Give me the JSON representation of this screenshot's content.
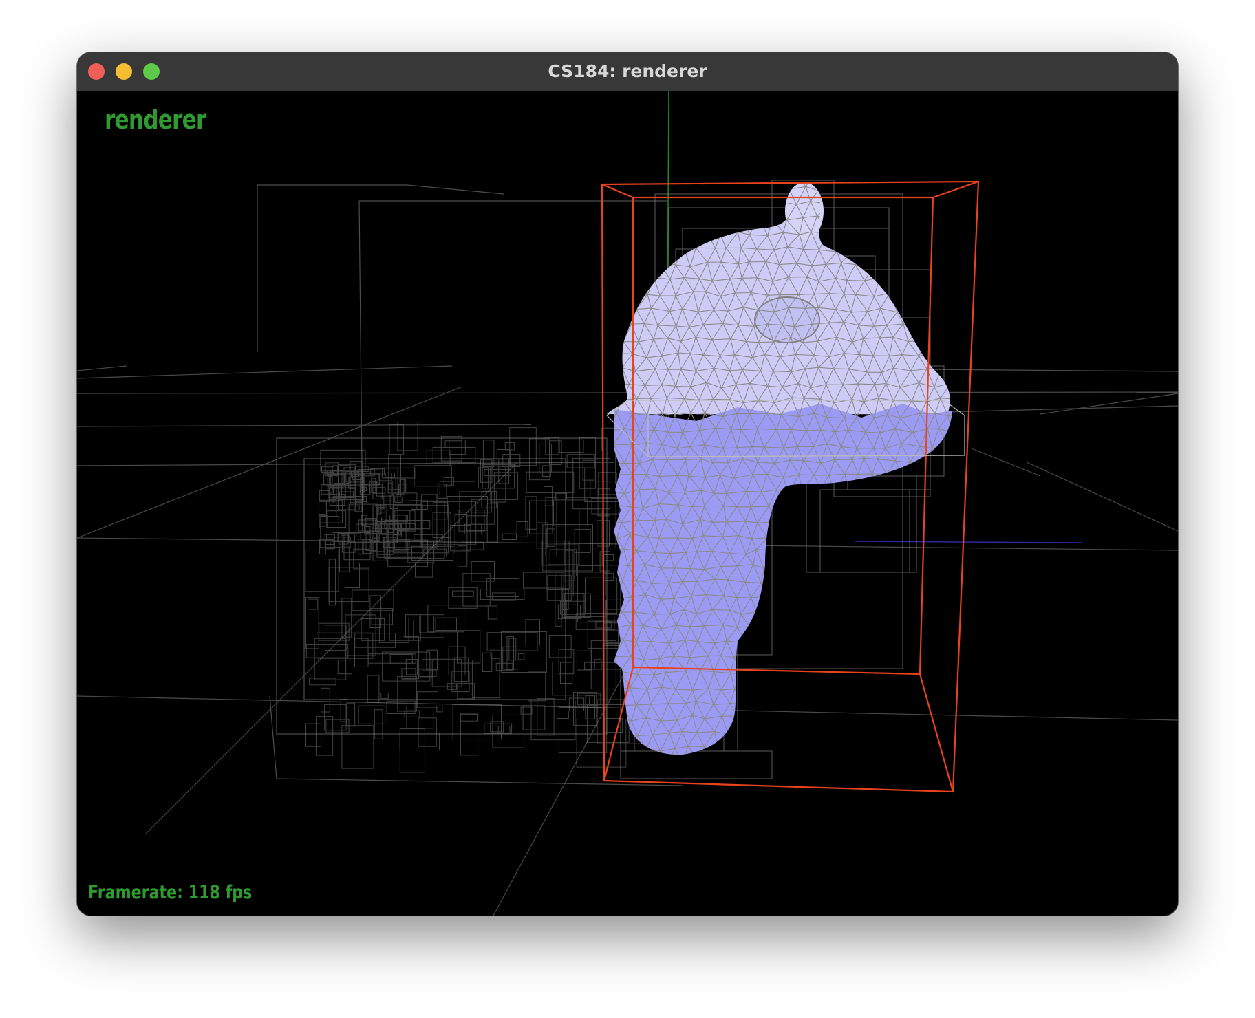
{
  "window": {
    "title": "CS184: renderer"
  },
  "hud": {
    "title": "renderer",
    "framerate": "Framerate: 118 fps"
  },
  "colors": {
    "hud_text": "#2f9a2f",
    "selected_bbox": "#e8431c",
    "mesh_light": "#ccccf7",
    "mesh_dark": "#9b9bf5",
    "wireframe": "#8a8a8a"
  },
  "scene": {
    "icons": [
      "close-icon",
      "minimize-icon",
      "maximize-icon"
    ]
  }
}
